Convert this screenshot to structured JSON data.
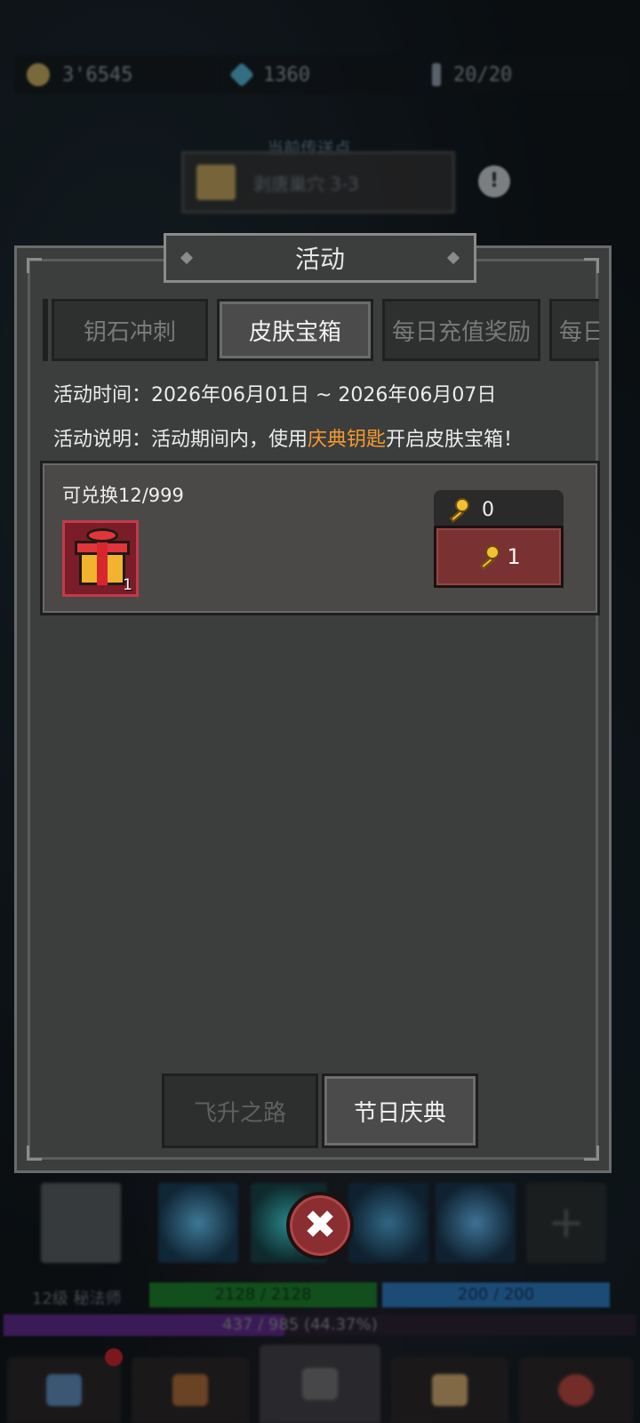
{
  "resources": {
    "gold": "3'6545",
    "gems": "1360",
    "stamina": "20/20"
  },
  "portal": {
    "caption": "当前传送点",
    "location": "剥唐巢穴 3-3"
  },
  "modal": {
    "title": "活动",
    "tabs": [
      "钥石冲刺",
      "皮肤宝箱",
      "每日充值奖励",
      "每日"
    ],
    "active_tab": "皮肤宝箱",
    "event_time": "活动时间：2026年06月01日 ~ 2026年06月07日",
    "desc_prefix": "活动说明：活动期间内，使用",
    "desc_highlight": "庆典钥匙",
    "desc_suffix": "开启皮肤宝箱！",
    "reward": {
      "redeem_count": "可兑换12/999",
      "item_icon": "gift-box-icon",
      "item_qty": "1",
      "key_owned": "0",
      "key_cost": "1"
    },
    "bottom_tabs": [
      "飞升之路",
      "节日庆典"
    ],
    "active_bottom_tab": "节日庆典"
  },
  "hud": {
    "player_name": "12级 秘法师",
    "hp": "2128 / 2128",
    "mp": "200 / 200",
    "xp": "437 / 985 (44.37%)",
    "xp_fraction": 0.4437
  },
  "colors": {
    "highlight": "#f39a2f",
    "redeem_button": "#7a3131",
    "close_button": "#8b2e31"
  }
}
